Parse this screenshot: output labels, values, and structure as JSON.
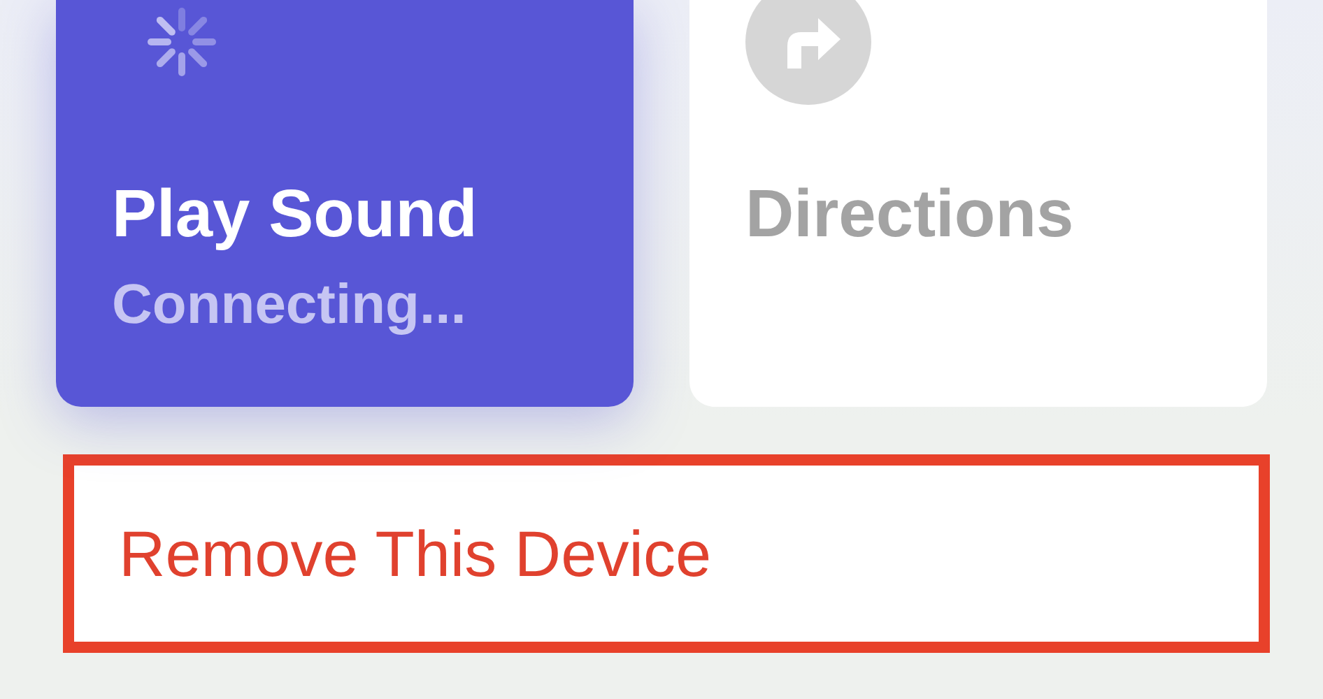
{
  "actions": [
    {
      "kind": "sound",
      "label": "Play Sound",
      "status": "Connecting...",
      "active": true
    },
    {
      "kind": "directions",
      "label": "Directions",
      "active": false
    }
  ],
  "remove_button": {
    "label": "Remove This Device",
    "highlighted": true
  }
}
